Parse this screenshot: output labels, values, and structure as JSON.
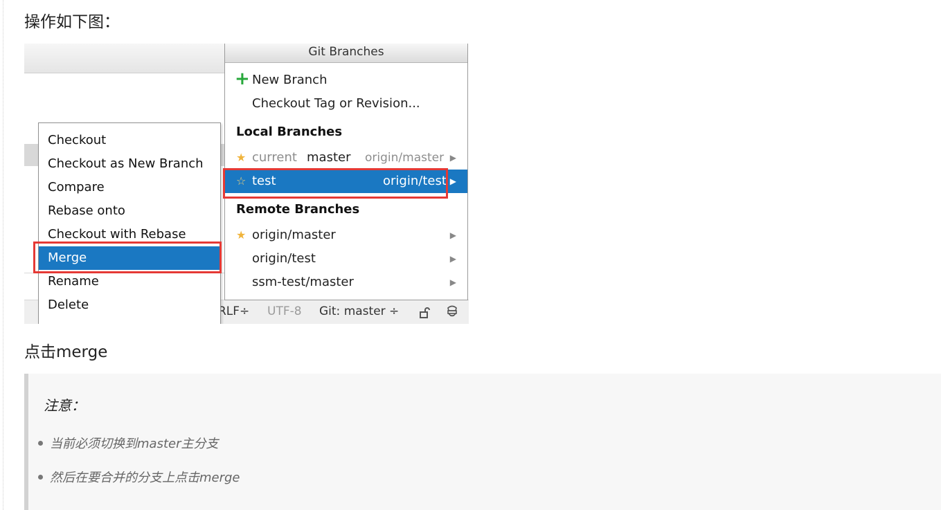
{
  "heading": "操作如下图：",
  "figure": {
    "popup": {
      "title": "Git Branches",
      "new_branch": "New Branch",
      "checkout_tag": "Checkout Tag or Revision...",
      "local_header": "Local Branches",
      "local": [
        {
          "tag": "current",
          "name": "master",
          "remote": "origin/master"
        },
        {
          "name": "test",
          "remote": "origin/test"
        }
      ],
      "remote_header": "Remote Branches",
      "remote": [
        "origin/master",
        "origin/test",
        "ssm-test/master"
      ]
    },
    "context_menu": [
      "Checkout",
      "Checkout as New Branch",
      "Compare",
      "Rebase onto",
      "Checkout with Rebase",
      "Merge",
      "Rename",
      "Delete"
    ],
    "status_bar": {
      "line_sep": "RLF÷",
      "encoding": "UTF-8",
      "git": "Git: master ÷"
    },
    "icons": {
      "star": "star-icon",
      "plus": "plus-icon",
      "arrow": "submenu-arrow-icon",
      "lock": "lock-icon",
      "inspector": "inspector-icon"
    },
    "colors": {
      "selection": "#1a78c2",
      "highlight_box": "#e53935",
      "plus": "#27a83b",
      "star": "#f0b43c"
    }
  },
  "caption": "点击merge",
  "note": {
    "title": "注意：",
    "items": [
      "当前必须切换到master主分支",
      "然后在要合并的分支上点击merge"
    ]
  }
}
